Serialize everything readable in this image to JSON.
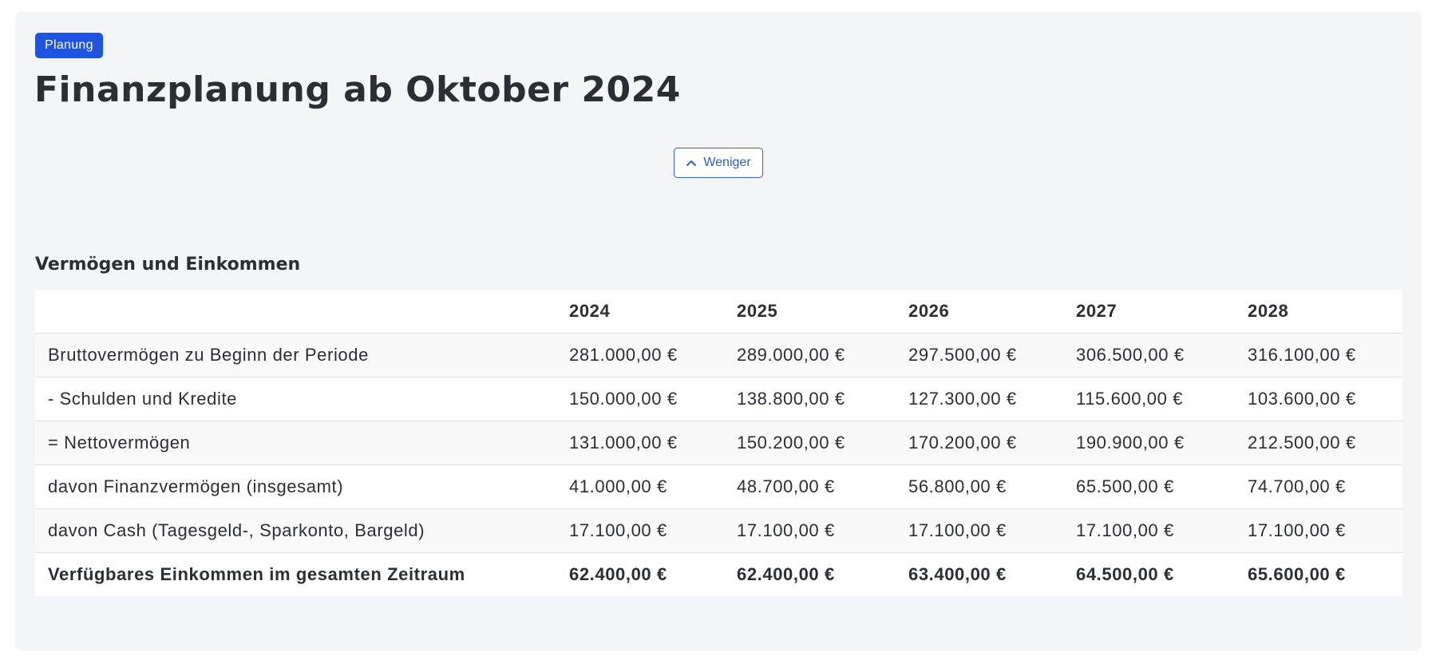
{
  "header": {
    "badge": "Planung",
    "title": "Finanzplanung ab Oktober 2024",
    "toggle_label": "Weniger",
    "toggle_icon": "chevron-up-icon"
  },
  "section": {
    "title": "Vermögen und Einkommen"
  },
  "table": {
    "headers": [
      "",
      "2024",
      "2025",
      "2026",
      "2027",
      "2028"
    ],
    "rows": [
      [
        "Bruttovermögen zu Beginn der Periode",
        "281.000,00 €",
        "289.000,00 €",
        "297.500,00 €",
        "306.500,00 €",
        "316.100,00 €"
      ],
      [
        "- Schulden und Kredite",
        "150.000,00 €",
        "138.800,00 €",
        "127.300,00 €",
        "115.600,00 €",
        "103.600,00 €"
      ],
      [
        "= Nettovermögen",
        "131.000,00 €",
        "150.200,00 €",
        "170.200,00 €",
        "190.900,00 €",
        "212.500,00 €"
      ],
      [
        "davon Finanzvermögen (insgesamt)",
        "41.000,00 €",
        "48.700,00 €",
        "56.800,00 €",
        "65.500,00 €",
        "74.700,00 €"
      ],
      [
        "davon Cash (Tagesgeld-, Sparkonto, Bargeld)",
        "17.100,00 €",
        "17.100,00 €",
        "17.100,00 €",
        "17.100,00 €",
        "17.100,00 €"
      ],
      [
        "Verfügbares Einkommen im gesamten Zeitraum",
        "62.400,00 €",
        "62.400,00 €",
        "63.400,00 €",
        "64.500,00 €",
        "65.600,00 €"
      ]
    ]
  },
  "colors": {
    "badge": "#1f54e0",
    "accent": "#2f5fc9",
    "card_background": "#f4f5f7",
    "text": "#2b2e33"
  }
}
